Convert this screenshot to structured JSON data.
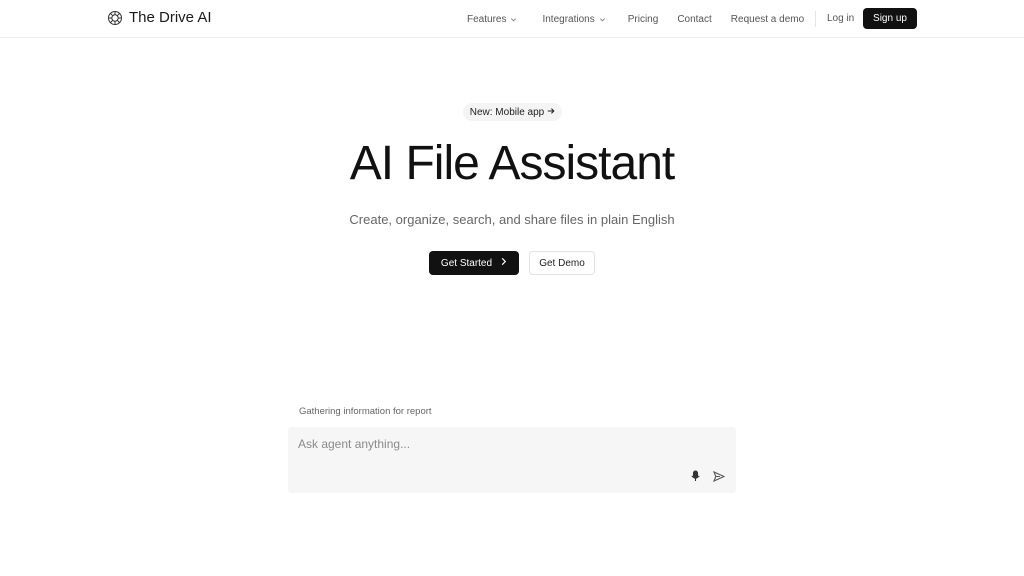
{
  "header": {
    "brand": "The Drive AI",
    "nav": {
      "features": "Features",
      "integrations": "Integrations",
      "pricing": "Pricing",
      "contact": "Contact",
      "request_demo": "Request a demo",
      "login": "Log in",
      "signup": "Sign up"
    }
  },
  "hero": {
    "badge": "New: Mobile app",
    "badge_icon": "arrow-right-icon",
    "title": "AI File Assistant",
    "subtitle": "Create, organize, search, and share files in plain English",
    "primary_cta": "Get Started",
    "secondary_cta": "Get Demo"
  },
  "agent": {
    "status": "Gathering information for report",
    "placeholder": "Ask agent anything...",
    "value": "",
    "icons": [
      "microphone-icon",
      "send-icon"
    ]
  },
  "colors": {
    "primary": "#111111",
    "background": "#ffffff",
    "input_bg": "#f6f6f6",
    "muted_text": "#666666"
  }
}
